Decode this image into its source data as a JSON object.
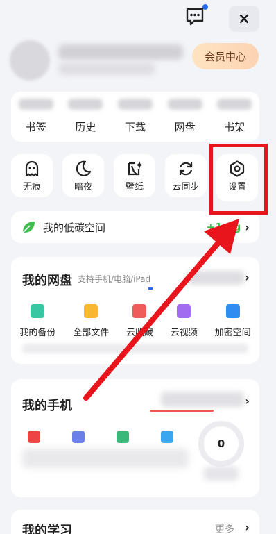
{
  "header": {
    "message_icon": "chat-bubble-icon",
    "close_label": "×"
  },
  "profile": {
    "vip_button": "会员中心"
  },
  "quick_links": [
    {
      "label": "书签"
    },
    {
      "label": "历史"
    },
    {
      "label": "下载"
    },
    {
      "label": "网盘"
    },
    {
      "label": "书架"
    }
  ],
  "tools": [
    {
      "label": "无痕",
      "icon": "ghost-icon"
    },
    {
      "label": "暗夜",
      "icon": "moon-icon"
    },
    {
      "label": "壁纸",
      "icon": "wallpaper-icon"
    },
    {
      "label": "云同步",
      "icon": "sync-icon"
    },
    {
      "label": "设置",
      "icon": "settings-hexagon-icon"
    }
  ],
  "carbon": {
    "label": "我的低碳空间",
    "value": "+1.0g"
  },
  "disk": {
    "title": "我的网盘",
    "subtitle": "支持手机/电脑/iPad",
    "items": [
      {
        "label": "我的备份",
        "color": "#39c7a3"
      },
      {
        "label": "全部文件",
        "color": "#f7b733"
      },
      {
        "label": "云收藏",
        "color": "#ef5b5b"
      },
      {
        "label": "云视频",
        "color": "#a26cf0"
      },
      {
        "label": "加密空间",
        "color": "#2f8cf0"
      }
    ]
  },
  "phone": {
    "title": "我的手机",
    "gauge_value": "0",
    "icon_colors": [
      "#ef4444",
      "#6b7fe8",
      "#3ab87a",
      "#3ba7f0"
    ]
  },
  "learn": {
    "title": "我的学习",
    "more": "更多"
  },
  "chevron": "›"
}
